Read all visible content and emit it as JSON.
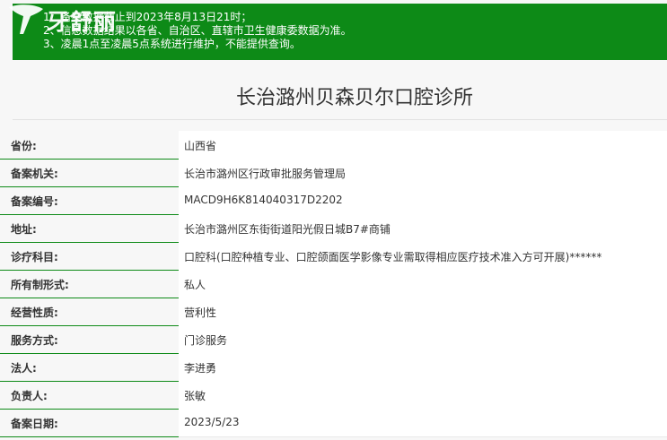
{
  "notice": {
    "lines": [
      "1、备案数据截止到2023年8月13日21时；",
      "2、信息数据结果以各省、自治区、直辖市卫生健康委数据为准。",
      "3、凌晨1点至凌晨5点系统进行维护，不能提供查询。"
    ]
  },
  "watermark": {
    "text": "牙舒丽"
  },
  "page": {
    "title": "长治潞州贝森贝尔口腔诊所"
  },
  "records": [
    {
      "label": "省份:",
      "value": "山西省"
    },
    {
      "label": "备案机关:",
      "value": "长治市潞州区行政审批服务管理局"
    },
    {
      "label": "备案编号:",
      "value": "MACD9H6K814040317D2202"
    },
    {
      "label": "地址:",
      "value": "长治市潞州区东街街道阳光假日城B7#商铺"
    },
    {
      "label": "诊疗科目:",
      "value": "口腔科(口腔种植专业、口腔颌面医学影像专业需取得相应医疗技术准入方可开展)******"
    },
    {
      "label": "所有制形式:",
      "value": "私人"
    },
    {
      "label": "经营性质:",
      "value": "营利性"
    },
    {
      "label": "服务方式:",
      "value": "门诊服务"
    },
    {
      "label": "法人:",
      "value": "李进勇"
    },
    {
      "label": "负责人:",
      "value": "张敏"
    },
    {
      "label": "备案日期:",
      "value": "2023/5/23"
    }
  ],
  "colors": {
    "notice_bg": "#0d8a17",
    "row_rule": "#0d8a17",
    "page_bg": "#f7f7f7"
  }
}
